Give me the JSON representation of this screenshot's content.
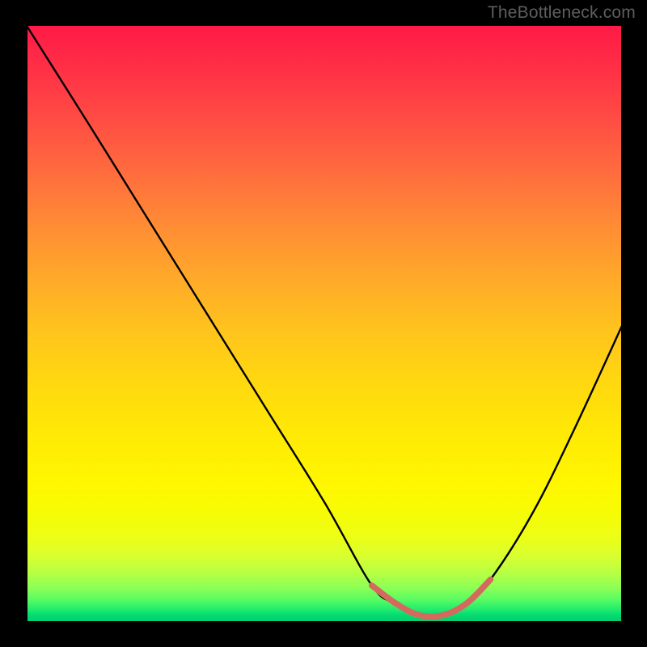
{
  "watermark": "TheBottleneck.com",
  "chart_data": {
    "type": "line",
    "title": "",
    "xlabel": "",
    "ylabel": "",
    "xlim": [
      0,
      100
    ],
    "ylim": [
      0,
      100
    ],
    "grid": false,
    "legend": false,
    "series": [
      {
        "name": "bottleneck-curve",
        "color": "#000000",
        "x": [
          0,
          10,
          20,
          30,
          40,
          50,
          58,
          62,
          66,
          70,
          74,
          78,
          85,
          92,
          100
        ],
        "values": [
          100,
          84,
          68,
          52,
          36,
          20,
          6,
          3,
          1,
          1,
          3,
          7,
          18,
          32,
          50
        ]
      },
      {
        "name": "optimal-range",
        "color": "#d46a5e",
        "x": [
          58,
          62,
          66,
          70,
          74,
          78
        ],
        "values": [
          6,
          3,
          1,
          1,
          3,
          7
        ]
      }
    ],
    "annotations": []
  }
}
